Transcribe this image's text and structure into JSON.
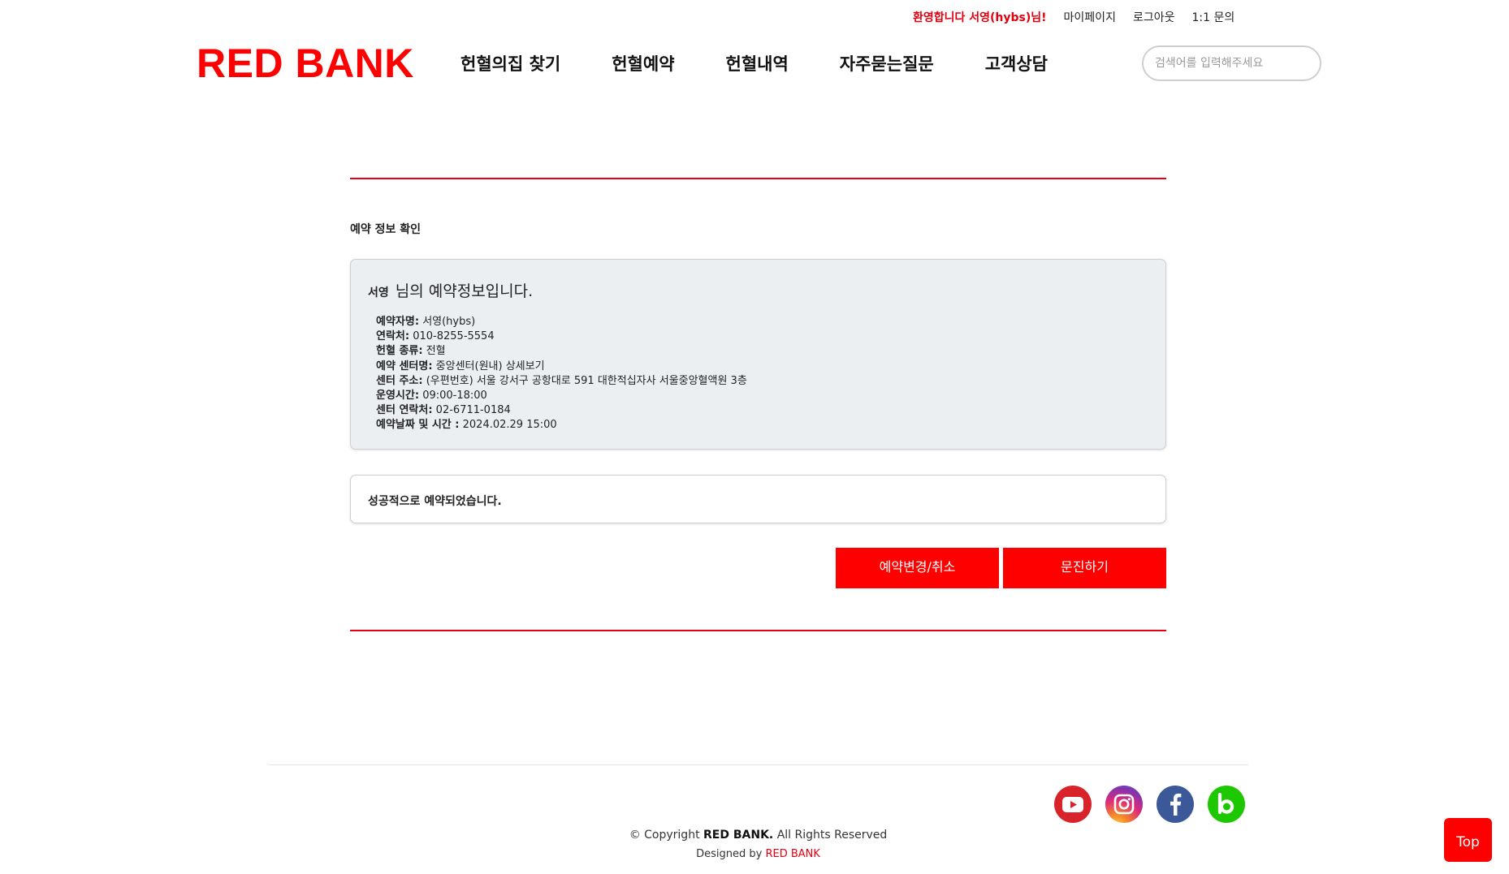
{
  "topbar": {
    "welcome": "환영합니다 서영(hybs)님!",
    "links": [
      "마이페이지",
      "로그아웃",
      "1:1 문의"
    ]
  },
  "header": {
    "logo": "RED BANK",
    "nav": [
      "헌혈의집 찾기",
      "헌혈예약",
      "헌혈내역",
      "자주묻는질문",
      "고객상담"
    ],
    "search_placeholder": "검색어를 입력해주세요"
  },
  "main": {
    "section_title": "예약 정보 확인",
    "greeting_name": "서영",
    "greeting_text": "님의 예약정보입니다.",
    "info": [
      {
        "label": "예약자명:",
        "value": "서영(hybs)"
      },
      {
        "label": "연락처:",
        "value": "010-8255-5554"
      },
      {
        "label": "헌혈 종류:",
        "value": "전혈"
      },
      {
        "label": "예약 센터명:",
        "value": "중앙센터(원내) 상세보기"
      },
      {
        "label": "센터 주소:",
        "value": "(우편번호) 서울 강서구 공항대로 591 대한적십자사 서울중앙혈액원 3층"
      },
      {
        "label": "운영시간:",
        "value": "09:00-18:00"
      },
      {
        "label": "센터 연락처:",
        "value": "02-6711-0184"
      },
      {
        "label": "예약날짜 및 시간 :",
        "value": "2024.02.29 15:00"
      }
    ],
    "result_message": "성공적으로 예약되었습니다.",
    "buttons": {
      "edit": "예약변경/취소",
      "exam": "문진하기"
    }
  },
  "footer": {
    "sns": [
      "youtube-icon",
      "instagram-icon",
      "facebook-icon",
      "band-icon"
    ],
    "copyright_prefix": "© Copyright",
    "copyright_brand": "RED BANK.",
    "copyright_suffix": "All Rights Reserved",
    "designed_prefix": "Designed by",
    "designed_brand": "RED BANK"
  },
  "top_button": "Top",
  "colors": {
    "accent": "#ff0000",
    "rule": "#e60012",
    "info_bg": "#eceff2"
  }
}
